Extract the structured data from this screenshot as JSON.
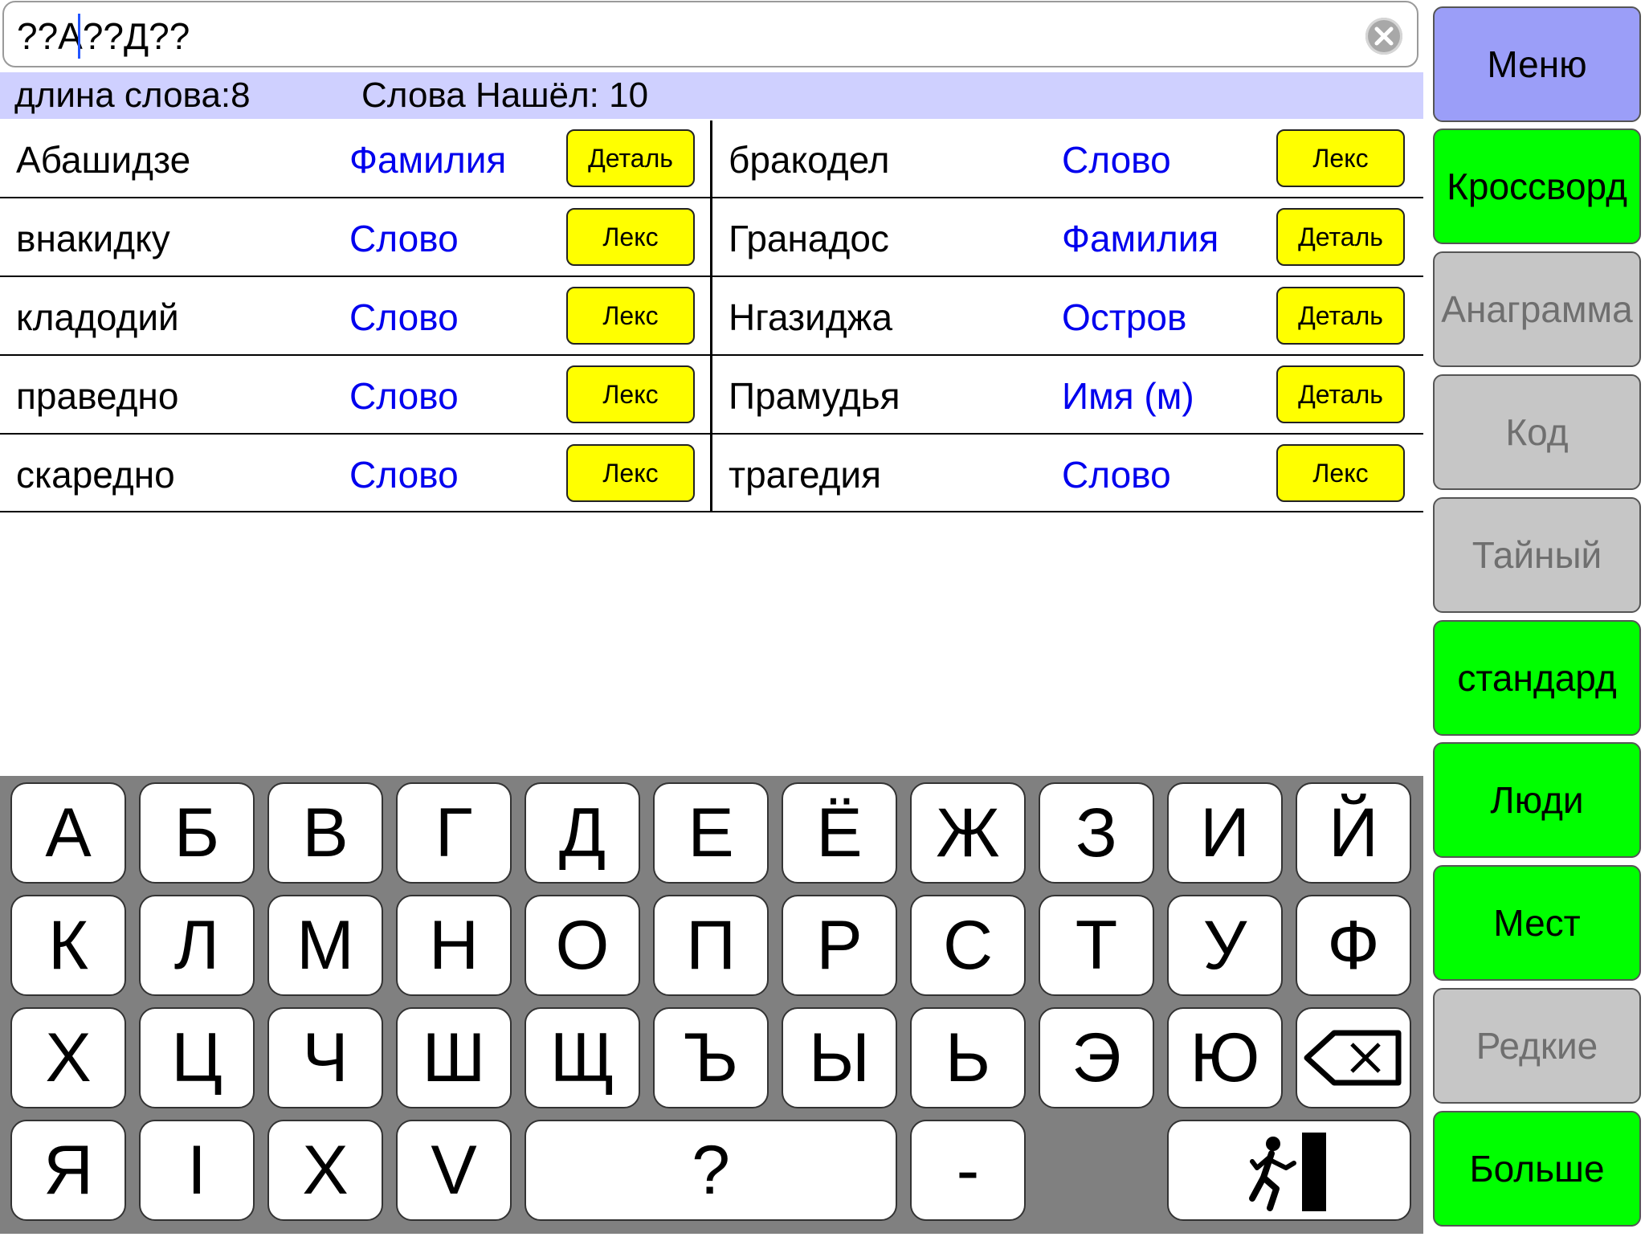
{
  "search": {
    "value": "??А??Д??"
  },
  "info": {
    "length_label": "длина слова:8",
    "found_label": "Слова Нашёл: 10"
  },
  "results": [
    {
      "word": "Абашидзе",
      "type": "Фамилия",
      "button": "Деталь"
    },
    {
      "word": "внакидку",
      "type": "Слово",
      "button": "Лекс"
    },
    {
      "word": "кладодий",
      "type": "Слово",
      "button": "Лекс"
    },
    {
      "word": "праведно",
      "type": "Слово",
      "button": "Лекс"
    },
    {
      "word": "скаредно",
      "type": "Слово",
      "button": "Лекс"
    },
    {
      "word": "бракодел",
      "type": "Слово",
      "button": "Лекс"
    },
    {
      "word": "Гранадос",
      "type": "Фамилия",
      "button": "Деталь"
    },
    {
      "word": "Нгазиджа",
      "type": "Остров",
      "button": "Деталь"
    },
    {
      "word": "Прамудья",
      "type": "Имя (м)",
      "button": "Деталь"
    },
    {
      "word": "трагедия",
      "type": "Слово",
      "button": "Лекс"
    }
  ],
  "keyboard": {
    "rows": [
      [
        "А",
        "Б",
        "В",
        "Г",
        "Д",
        "Е",
        "Ё",
        "Ж",
        "З",
        "И",
        "Й"
      ],
      [
        "К",
        "Л",
        "М",
        "Н",
        "О",
        "П",
        "Р",
        "С",
        "Т",
        "У",
        "Ф"
      ],
      [
        "Х",
        "Ц",
        "Ч",
        "Ш",
        "Щ",
        "Ъ",
        "Ы",
        "Ь",
        "Э",
        "Ю"
      ],
      [
        "Я",
        "I",
        "X",
        "V"
      ]
    ],
    "wildcard": "?",
    "hyphen": "-",
    "backspace_icon": "backspace-icon",
    "exit_icon": "exit-icon"
  },
  "sidebar": {
    "items": [
      {
        "label": "Меню",
        "style": "blue"
      },
      {
        "label": "Кроссворд",
        "style": "green"
      },
      {
        "label": "Анаграмма",
        "style": "gray"
      },
      {
        "label": "Код",
        "style": "gray"
      },
      {
        "label": "Тайный",
        "style": "gray"
      },
      {
        "label": "стандард",
        "style": "green"
      },
      {
        "label": "Люди",
        "style": "green"
      },
      {
        "label": "Мест",
        "style": "green"
      },
      {
        "label": "Редкие",
        "style": "gray"
      },
      {
        "label": "Больше",
        "style": "green"
      }
    ]
  },
  "colors": {
    "info_bar": "#cfd0ff",
    "action_button": "#ffff00",
    "word_type": "#0000ee",
    "menu_blue": "#9b9ef8",
    "menu_green": "#00ff00",
    "menu_gray": "#c6c6c6",
    "keyboard_bg": "#808080"
  }
}
